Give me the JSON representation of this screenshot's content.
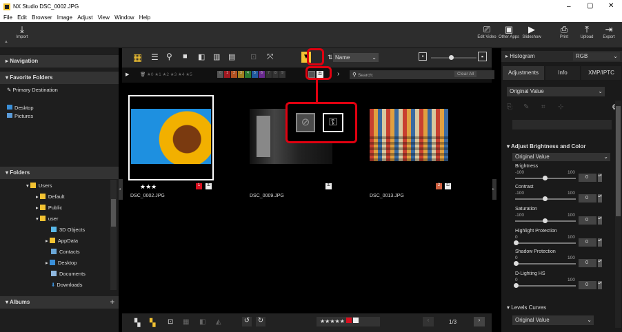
{
  "title": "NX Studio   DSC_0002.JPG",
  "window_controls": {
    "min": "–",
    "max": "▢",
    "close": "✕"
  },
  "menu": [
    "File",
    "Edit",
    "Browser",
    "Image",
    "Adjust",
    "View",
    "Window",
    "Help"
  ],
  "toolbar": {
    "import": "Import",
    "edit_video": "Edit Video",
    "other_apps": "Other Apps",
    "slideshow": "Slideshow",
    "print": "Print",
    "upload": "Upload",
    "export": "Export"
  },
  "left": {
    "navigation": "Navigation",
    "favorite_folders": "Favorite Folders",
    "primary_destination": "Primary Destination",
    "desktop": "Desktop",
    "pictures": "Pictures",
    "folders": "Folders",
    "tree": [
      "Users",
      "Default",
      "Public",
      "user",
      "3D Objects",
      "AppData",
      "Contacts",
      "Desktop",
      "Documents",
      "Downloads"
    ],
    "albums": "Albums"
  },
  "center": {
    "sort": "Name",
    "filter_bar": "★0 ★1 ★2 ★3 ★4 ★5",
    "search_placeholder": "Search:",
    "clear_all": "Clear All",
    "labels": [
      "0",
      "1",
      "2",
      "3",
      "4",
      "5",
      "6",
      "7",
      "8",
      "9"
    ],
    "thumbs": [
      {
        "name": "DSC_0002.JPG",
        "rating": "★★★",
        "label": "1"
      },
      {
        "name": "DSC_0009.JPG",
        "rating": "",
        "label": ""
      },
      {
        "name": "DSC_0013.JPG",
        "rating": "",
        "label": "2"
      }
    ],
    "page": "1/3",
    "bottom_rating": "★★★★★"
  },
  "right": {
    "histogram": "Histogram",
    "channel": "RGB",
    "tabs": [
      "Adjustments",
      "Info",
      "XMP/IPTC"
    ],
    "preset": "Original Value",
    "section": "Adjust Brightness and Color",
    "section_preset": "Original Value",
    "sliders": [
      {
        "label": "Brightness",
        "min": "-100",
        "max": "100",
        "value": "0"
      },
      {
        "label": "Contrast",
        "min": "-100",
        "max": "100",
        "value": "0"
      },
      {
        "label": "Saturation",
        "min": "-100",
        "max": "100",
        "value": "0"
      },
      {
        "label": "Highlight Protection",
        "min": "0",
        "max": "100",
        "value": "0"
      },
      {
        "label": "Shadow Protection",
        "min": "0",
        "max": "100",
        "value": "0"
      },
      {
        "label": "D-Lighting HS",
        "min": "0",
        "max": "100",
        "value": "0"
      }
    ],
    "levels": "Levels Curves",
    "levels_preset": "Original Value"
  }
}
